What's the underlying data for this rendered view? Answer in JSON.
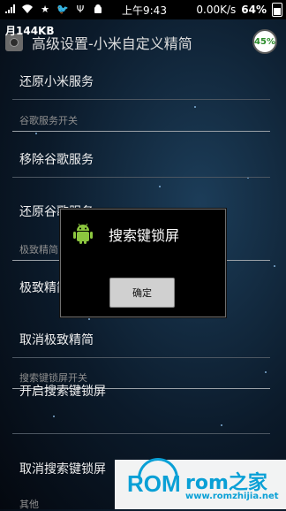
{
  "status_bar": {
    "time": "上午9:43",
    "net_speed": "0.00K/s",
    "battery_percent": "64%"
  },
  "header": {
    "title": "高级设置-小米自定义精简",
    "traffic_overlay": "月144KB",
    "progress_percent": "45%"
  },
  "list": {
    "items": [
      {
        "kind": "item",
        "label": "还原小米服务"
      },
      {
        "kind": "section",
        "label": "谷歌服务开关"
      },
      {
        "kind": "item",
        "label": "移除谷歌服务"
      },
      {
        "kind": "item",
        "label": "还原谷歌服务"
      },
      {
        "kind": "section",
        "label": "极致精简"
      },
      {
        "kind": "item",
        "label": "极致精简"
      },
      {
        "kind": "item",
        "label": "取消极致精简"
      },
      {
        "kind": "section",
        "label": "搜索键锁屏开关"
      },
      {
        "kind": "item",
        "label": "开启搜索键锁屏"
      },
      {
        "kind": "item",
        "label": "取消搜索键锁屏"
      },
      {
        "kind": "section",
        "label": "其他"
      }
    ]
  },
  "dialog": {
    "title": "搜索键锁屏",
    "confirm_label": "确定",
    "icon": "android-icon"
  },
  "watermark": {
    "rom_text": "ROM",
    "rom_cn": "rom之家",
    "url": "www.romzhijia.net"
  },
  "colors": {
    "accent": "#0aa0d6",
    "progress_text": "#2a8b2a"
  }
}
